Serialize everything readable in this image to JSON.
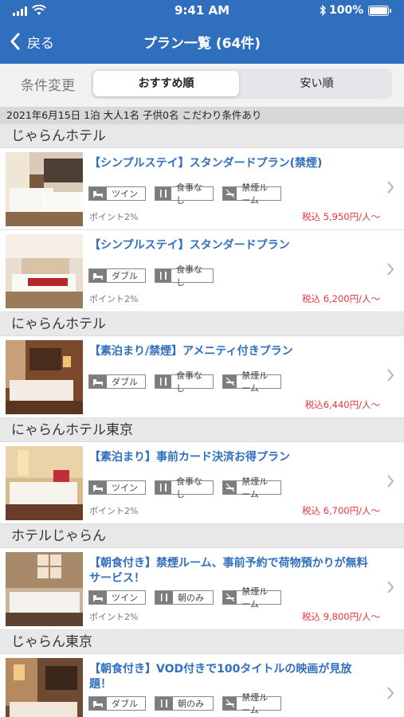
{
  "status": {
    "time": "9:41 AM",
    "battery": "100%"
  },
  "nav": {
    "back_label": "戻る",
    "title": "プラン一覧 (64件)"
  },
  "sort": {
    "condition_label": "条件変更",
    "options": [
      "おすすめ順",
      "安い順"
    ],
    "selected": "おすすめ順"
  },
  "search_summary": "2021年6月15日 1泊 大人1名 子供0名 こだわり条件あり",
  "colors": {
    "header": "#2f6fbd",
    "link": "#2f6fbd",
    "price": "#e8363f"
  },
  "hotels": [
    {
      "name": "じゃらんホテル",
      "plans": [
        {
          "title": "【シンプルステイ】スタンダードプラン(禁煙)",
          "tags": [
            "ツイン",
            "食事なし",
            "禁煙ルーム"
          ],
          "points": "ポイント2%",
          "price": "税込 5,950円/人～"
        },
        {
          "title": "【シンプルステイ】スタンダードプラン",
          "tags": [
            "ダブル",
            "食事なし"
          ],
          "points": "ポイント2%",
          "price": "税込 6,200円/人～"
        }
      ]
    },
    {
      "name": "にゃらんホテル",
      "plans": [
        {
          "title": "【素泊まり/禁煙】アメニティ付きプラン",
          "tags": [
            "ダブル",
            "食事なし",
            "禁煙ルーム"
          ],
          "points": "",
          "price": "税込6,440円/人～"
        }
      ]
    },
    {
      "name": "にゃらんホテル東京",
      "plans": [
        {
          "title": "【素泊まり】事前カード決済お得プラン",
          "tags": [
            "ツイン",
            "食事なし",
            "禁煙ルーム"
          ],
          "points": "ポイント2%",
          "price": "税込 6,700円/人～"
        }
      ]
    },
    {
      "name": "ホテルじゃらん",
      "plans": [
        {
          "title": "【朝食付き】禁煙ルーム、事前予約で荷物預かりが無料サービス！",
          "tags": [
            "ツイン",
            "朝のみ",
            "禁煙ルーム"
          ],
          "points": "ポイント2%",
          "price": "税込 9,800円/人～"
        }
      ]
    },
    {
      "name": "じゃらん東京",
      "plans": [
        {
          "title": "【朝食付き】VOD付きで100タイトルの映画が見放題！",
          "tags": [
            "ダブル",
            "朝のみ",
            "禁煙ルーム"
          ],
          "points": "",
          "price": ""
        }
      ]
    }
  ]
}
